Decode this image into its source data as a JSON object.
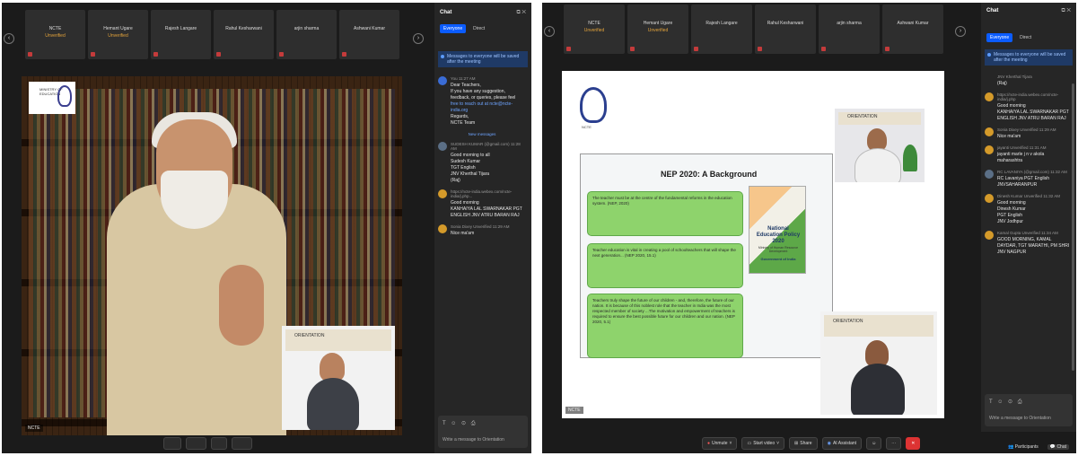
{
  "windows": [
    {
      "participants": [
        {
          "name": "NCTE",
          "status": "Unverified"
        },
        {
          "name": "Hemant Ugare",
          "status": "Unverified"
        },
        {
          "name": "Rajesh Langare",
          "status": ""
        },
        {
          "name": "Rahul Kesharwani",
          "status": ""
        },
        {
          "name": "arjin sharma",
          "status": ""
        },
        {
          "name": "Ashwani Kumar",
          "status": ""
        }
      ],
      "stage_label": "NCTE",
      "chat": {
        "title": "Chat",
        "tabs": [
          "Everyone",
          "Direct"
        ],
        "notice": "Messages to everyone will be saved after the meeting",
        "messages": [
          {
            "meta": "You 11:27 AM",
            "lines": [
              "Dear Teachers,",
              "",
              "If you have any suggestion,",
              "feedback, or queries, please feel",
              "free to reach out at ncte@ncte-",
              "india.org",
              "",
              "Regards,",
              "NCTE Team"
            ]
          },
          {
            "meta": "SUDESH KUMAR (@gmail.com) 11:28 AM",
            "lines": [
              "Good morning to all",
              "Sudesh Kumar",
              "TGT English",
              "JNV Kherthal Tijara",
              "(Raj)"
            ]
          },
          {
            "meta": "https://ncte-india.webex.com/ncte-india/j.php...",
            "lines": [
              "Good morning",
              "KANHAIYA LAL SWARNAKAR PGT",
              "ENGLISH JNV ATRU BARAN RAJ"
            ]
          },
          {
            "meta": "Sonia Dixey Unverified 11:29 AM",
            "lines": [
              "Nice ma'am"
            ]
          }
        ],
        "new_messages": "New messages",
        "composer_placeholder": "Write a message to Orientation"
      }
    },
    {
      "participants": [
        {
          "name": "NCTE",
          "status": "Unverified"
        },
        {
          "name": "Hemant Ugare",
          "status": "Unverified"
        },
        {
          "name": "Rajesh Langare",
          "status": ""
        },
        {
          "name": "Rahul Kesharwani",
          "status": ""
        },
        {
          "name": "arjin sharma",
          "status": ""
        },
        {
          "name": "Ashwani Kumar",
          "status": ""
        }
      ],
      "stage_label": "NCTE",
      "slide": {
        "title": "NEP 2020: A Background",
        "points": [
          "The teacher must be at the centre of the fundamental reforms in the education system. (NEP, 2020)",
          "Teacher education is vital in creating a pool of schoolteachers that will shape the next generation... (NEP 2020, 15.1)",
          "Teachers truly shape the future of our children - and, therefore, the future of our nation. It is because of this noblest role that the teacher in India was the most respected member of society ...The motivation and empowerment of teachers is required to ensure the best possible future for our children and our nation. (NEP 2020, 5.1)"
        ],
        "book_title": "National Education Policy 2020",
        "book_ministry": "Ministry of Human Resource Development",
        "book_gov": "Government of India",
        "logo_text": "NCTE"
      },
      "toolbar": [
        {
          "label": "Unmute"
        },
        {
          "label": "Start video"
        },
        {
          "label": "Share"
        },
        {
          "label": "AI Assistant"
        }
      ],
      "bottom_right": [
        "Participants",
        "Chat"
      ],
      "chat": {
        "title": "Chat",
        "tabs": [
          "Everyone",
          "Direct"
        ],
        "notice": "Messages to everyone will be saved after the meeting",
        "messages": [
          {
            "meta": "JNV Kherthal Tijara",
            "lines": [
              "(Raj)"
            ]
          },
          {
            "meta": "https://ncte-india.webex.com/ncte-india/j.php",
            "lines": [
              "Good morning",
              "KANHAIYA LAL SWARNAKAR PGT",
              "ENGLISH JNV ATRU BARAN RAJ"
            ]
          },
          {
            "meta": "Sonia Dixey Unverified 11:29 AM",
            "lines": [
              "Nice ma'am"
            ]
          },
          {
            "meta": "jayanti Unverified 11:31 AM",
            "lines": [
              "jayanti marle j n v akola",
              "maharashtra"
            ]
          },
          {
            "meta": "RC LAVANIYA (@gmail.com) 11:32 AM",
            "lines": [
              "RC Lavaniya PGT English",
              "JNVSAHARANPUR"
            ]
          },
          {
            "meta": "Dinesh Kumar Unverified 11:32 AM",
            "lines": [
              "Good morning",
              "Dinesh Kumar",
              "PGT English",
              "JNV Jodhpur"
            ]
          },
          {
            "meta": "Kamal Gupta Unverified 11:34 AM",
            "lines": [
              "GOOD MORNING, KAMAL",
              "DAYDAR, TGT MARATHI, PM SHRI",
              "JNV NAGPUR"
            ]
          }
        ],
        "composer_placeholder": "Write a message to Orientation"
      }
    }
  ],
  "colors": {
    "accent": "#0b5cff",
    "unverified": "#e3a33b",
    "leave": "#dd3333"
  }
}
